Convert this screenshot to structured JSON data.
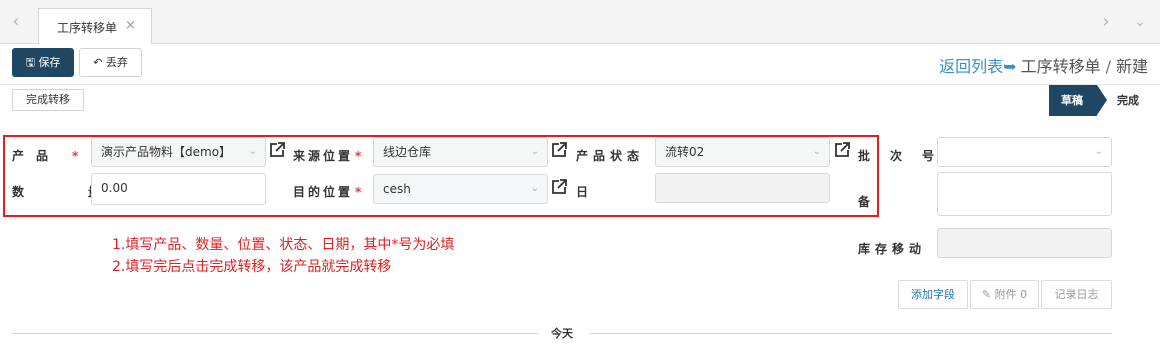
{
  "tabs": [
    {
      "label": "工序转移单",
      "close": "×"
    }
  ],
  "toolbar": {
    "save_label": "保存",
    "discard_label": "丢弃"
  },
  "breadcrumb": {
    "back_link": "返回列表",
    "doc_type": "工序转移单",
    "separator": "/",
    "current": "新建"
  },
  "actions": {
    "complete_transfer": "完成转移"
  },
  "stages": {
    "active": "草稿",
    "next": "完成"
  },
  "form": {
    "product": {
      "label": "产　品",
      "required": "*",
      "value": "演示产品物料【demo】"
    },
    "source_location": {
      "label": "来源位置",
      "required": "*",
      "value": "线边仓库"
    },
    "product_status": {
      "label": "产品状态",
      "value": "流转02"
    },
    "batch_number": {
      "label": "批　次　号",
      "value": ""
    },
    "quantity": {
      "label": "数　量",
      "value": "0.00"
    },
    "destination_location": {
      "label": "目的位置",
      "required": "*",
      "value": "cesh"
    },
    "date": {
      "label": "日　期",
      "value": ""
    },
    "remarks": {
      "label": "备　注",
      "value": ""
    },
    "stock_move": {
      "label": "库存移动",
      "value": ""
    }
  },
  "annotations": [
    "1.填写产品、数量、位置、状态、日期，其中*号为必填",
    "2.填写完后点击完成转移，该产品就完成转移"
  ],
  "chatter": {
    "add_field": "添加字段",
    "attachments": "附件 0",
    "log": "记录日志",
    "today": "今天"
  },
  "colors": {
    "primary": "#1f4764",
    "link": "#3a8fc6",
    "highlight": "#e02020",
    "required": "#e03a3a"
  }
}
